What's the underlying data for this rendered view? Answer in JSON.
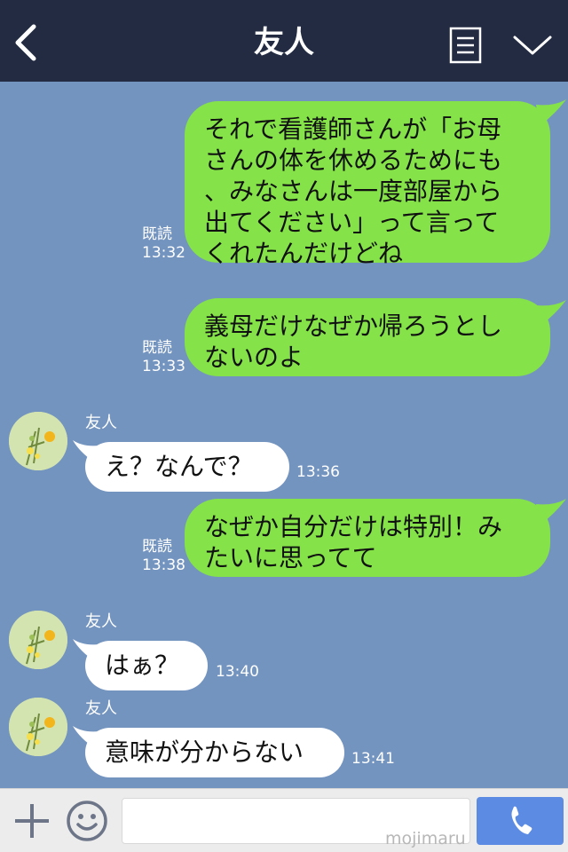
{
  "header": {
    "title": "友人",
    "back_icon": "chevron-left-icon",
    "menu_icon": "document-list-icon",
    "collapse_icon": "chevron-down-icon"
  },
  "messages": [
    {
      "side": "out",
      "lines": [
        "それで看護師さんが「お母",
        "さんの体を休めるためにも",
        "、みなさんは一度部屋から",
        "出てください」って言って",
        "くれたんだけどね"
      ],
      "read": "既読",
      "time": "13:32"
    },
    {
      "side": "out",
      "lines": [
        "義母だけなぜか帰ろうとし",
        "ないのよ"
      ],
      "read": "既読",
      "time": "13:33"
    },
    {
      "side": "in",
      "sender": "友人",
      "text": "え？なんで？",
      "time": "13:36"
    },
    {
      "side": "out",
      "lines": [
        "なぜか自分だけは特別！み",
        "たいに思ってて"
      ],
      "read": "既読",
      "time": "13:38"
    },
    {
      "side": "in",
      "sender": "友人",
      "text": "はぁ？",
      "time": "13:40"
    },
    {
      "side": "in",
      "sender": "友人",
      "text": "意味が分からない",
      "time": "13:41"
    }
  ],
  "footer": {
    "plus_icon": "plus-icon",
    "emoji_icon": "smiley-icon",
    "input_value": "",
    "watermark": "mojimaru",
    "call_icon": "phone-icon"
  },
  "colors": {
    "header_bg": "#222b42",
    "chat_bg": "#7494c0",
    "outgoing_bubble": "#85e249",
    "incoming_bubble": "#ffffff",
    "call_button": "#5b8be2"
  }
}
